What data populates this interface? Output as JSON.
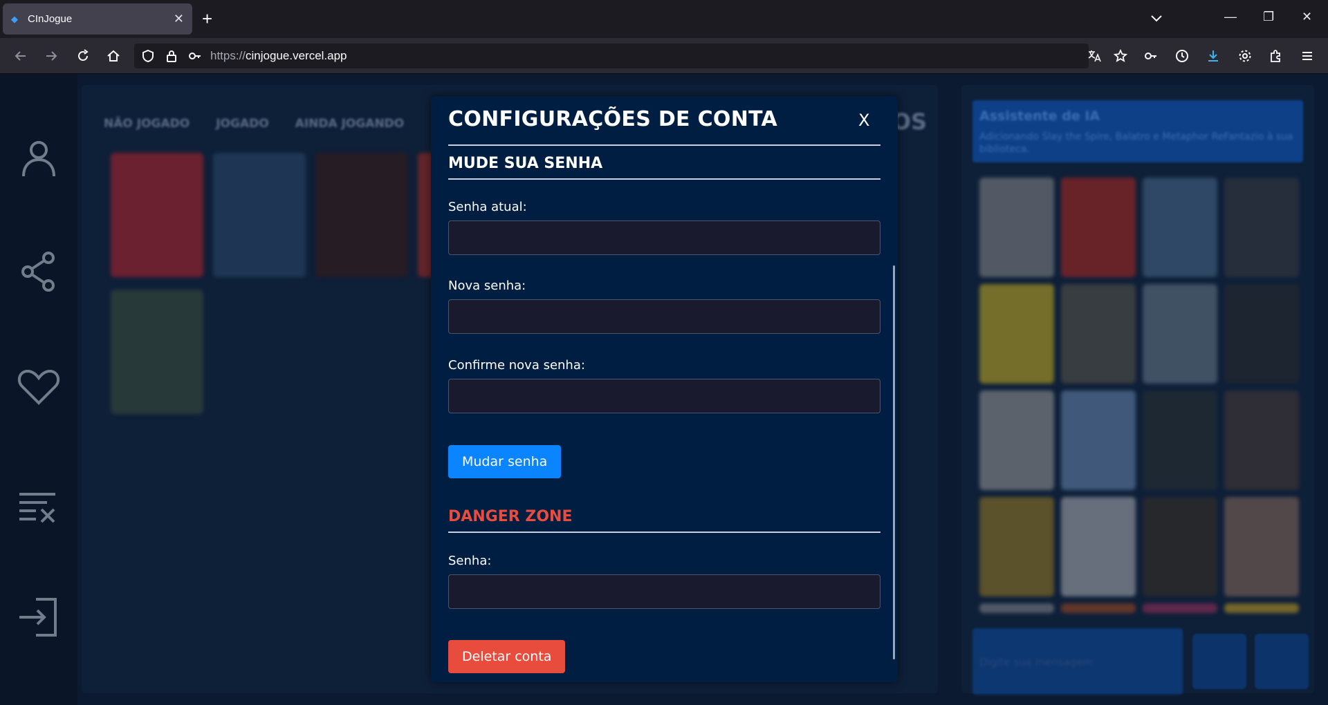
{
  "browser": {
    "tab_title": "CInJogue",
    "url_scheme": "https://",
    "url_host": "cinjogue.vercel.app"
  },
  "library": {
    "tabs": [
      "NÃO JOGADO",
      "JOGADO",
      "AINDA JOGANDO"
    ],
    "title_fragment": "OS"
  },
  "assistant": {
    "title": "Assistente de IA",
    "subtitle": "Adicionando Slay the Spire, Balatro e Metaphor ReFantazio à sua biblioteca.",
    "chat_placeholder": "Digite sua mensagem"
  },
  "modal": {
    "title": "CONFIGURAÇÕES DE CONTA",
    "close_label": "X",
    "password_section": "MUDE SUA SENHA",
    "current_password_label": "Senha atual:",
    "new_password_label": "Nova senha:",
    "confirm_password_label": "Confirme nova senha:",
    "change_password_button": "Mudar senha",
    "danger_section": "DANGER ZONE",
    "delete_password_label": "Senha:",
    "delete_account_button": "Deletar conta"
  },
  "colors": {
    "modal_bg": "#001e42",
    "primary": "#0a84ff",
    "danger": "#e84c3d"
  }
}
